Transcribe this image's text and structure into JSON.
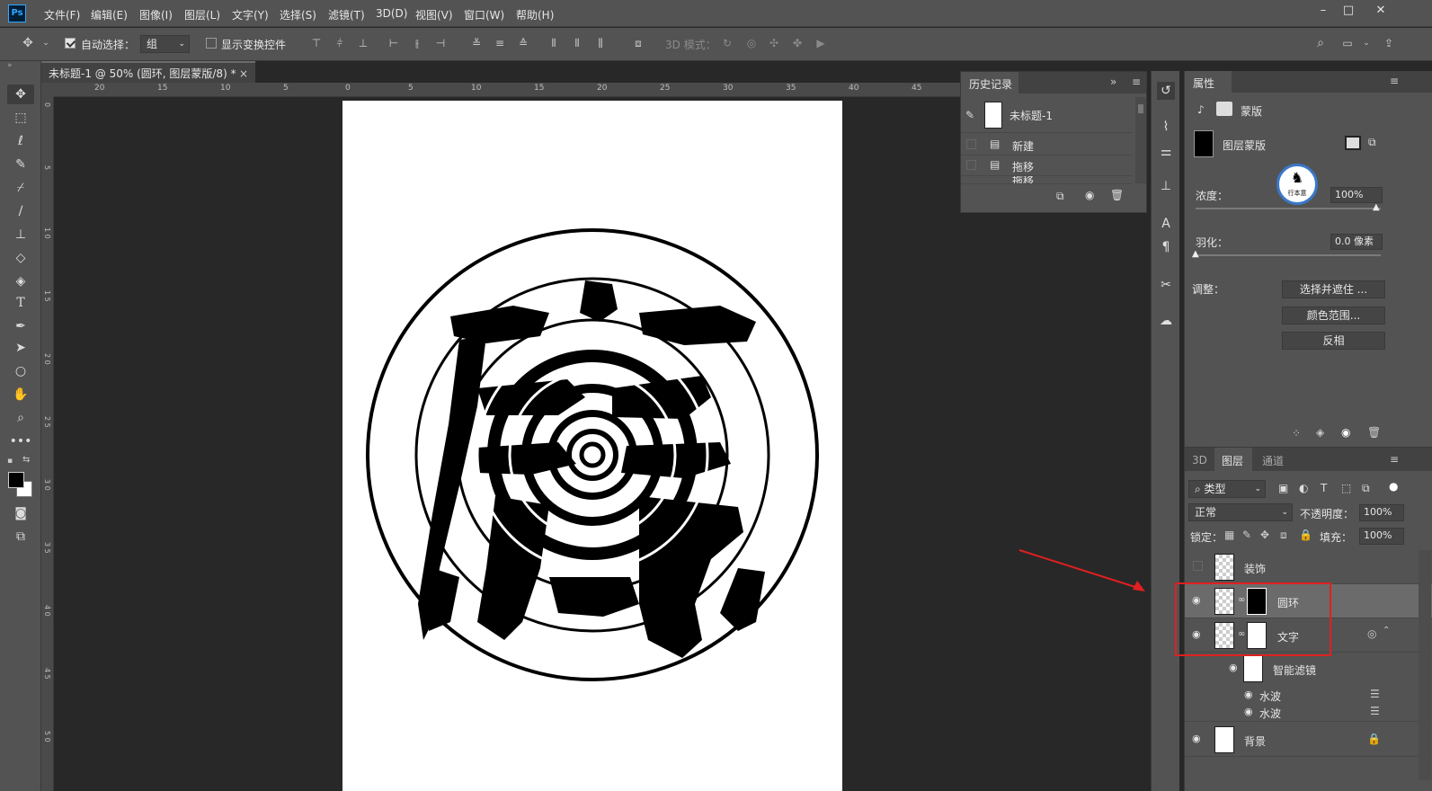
{
  "app": {
    "logo": "Ps"
  },
  "menu": [
    "文件(F)",
    "编辑(E)",
    "图像(I)",
    "图层(L)",
    "文字(Y)",
    "选择(S)",
    "滤镜(T)",
    "3D(D)",
    "视图(V)",
    "窗口(W)",
    "帮助(H)"
  ],
  "options": {
    "auto_select_label": "自动选择：",
    "auto_select_value": "组",
    "show_transform_label": "显示变换控件",
    "mode_3d_label": "3D 模式："
  },
  "document": {
    "tab_title": "未标题-1 @ 50% (圆环, 图层蒙版/8) *",
    "ruler_top": [
      "20",
      "15",
      "10",
      "5",
      "0",
      "5",
      "10",
      "15",
      "20",
      "25",
      "30",
      "35",
      "40",
      "45"
    ],
    "ruler_left": [
      "0",
      "5",
      "1 0",
      "1 5",
      "2 0",
      "2 5",
      "3 0",
      "3 5",
      "4 0",
      "4 5",
      "5 0"
    ]
  },
  "history": {
    "title": "历史记录",
    "snapshot": "未标题-1",
    "items": [
      "新建",
      "拖移",
      "拖移"
    ]
  },
  "properties": {
    "title": "属性",
    "mask_section": "蒙版",
    "layer_mask_label": "图层蒙版",
    "density_label": "浓度：",
    "density_value": "100%",
    "feather_label": "羽化：",
    "feather_value": "0.0 像素",
    "adjust_label": "调整：",
    "btn_select_mask": "选择并遮住 ...",
    "btn_color_range": "颜色范围...",
    "btn_invert": "反相",
    "watermark_text": "行本意"
  },
  "layers_panel": {
    "tabs": [
      "3D",
      "图层",
      "通道"
    ],
    "active_tab": "图层",
    "filter_kind": "类型",
    "blend_mode": "正常",
    "opacity_label": "不透明度：",
    "opacity_value": "100%",
    "lock_label": "锁定：",
    "fill_label": "填充：",
    "fill_value": "100%",
    "layers": [
      {
        "name": "装饰",
        "visible": false
      },
      {
        "name": "圆环",
        "visible": true,
        "selected": true
      },
      {
        "name": "文字",
        "visible": true
      },
      {
        "name": "智能滤镜",
        "visible": true
      },
      {
        "name": "水波",
        "visible": true
      },
      {
        "name": "水波",
        "visible": true
      },
      {
        "name": "背景",
        "visible": true,
        "locked": true
      }
    ]
  },
  "colors": {
    "annotation_red": "#e0201f",
    "selection_box": "#e02020"
  }
}
